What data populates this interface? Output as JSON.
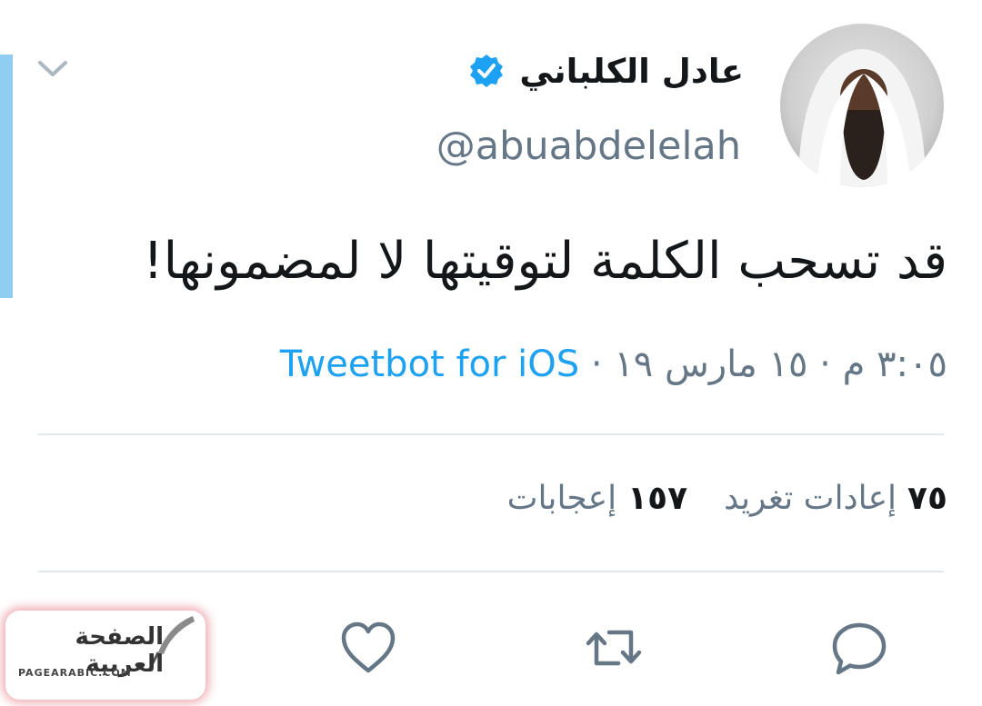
{
  "tweet": {
    "display_name": "عادل الكلباني",
    "handle": "@abuabdelelah",
    "text": "قد تسحب الكلمة لتوقيتها لا لمضمونها!",
    "timestamp": "٣:٠٥ م · ١٥ مارس ١٩ ·",
    "source": "Tweetbot for iOS",
    "retweets_count": "٧٥",
    "retweets_label": "إعادات تغريد",
    "likes_count": "١٥٧",
    "likes_label": "إعجابات"
  },
  "icons": {
    "menu": "chevron-down-icon",
    "verified": "verified-badge-icon",
    "reply": "reply-icon",
    "retweet": "retweet-icon",
    "like": "heart-icon"
  },
  "watermark": {
    "text": "الصفحة العربية",
    "url": "PAGEARABIC.COM"
  },
  "colors": {
    "accent": "#1da1f2",
    "muted": "#657786",
    "divider": "#e1e8ed",
    "thread_bar": "#8fcdf3"
  }
}
